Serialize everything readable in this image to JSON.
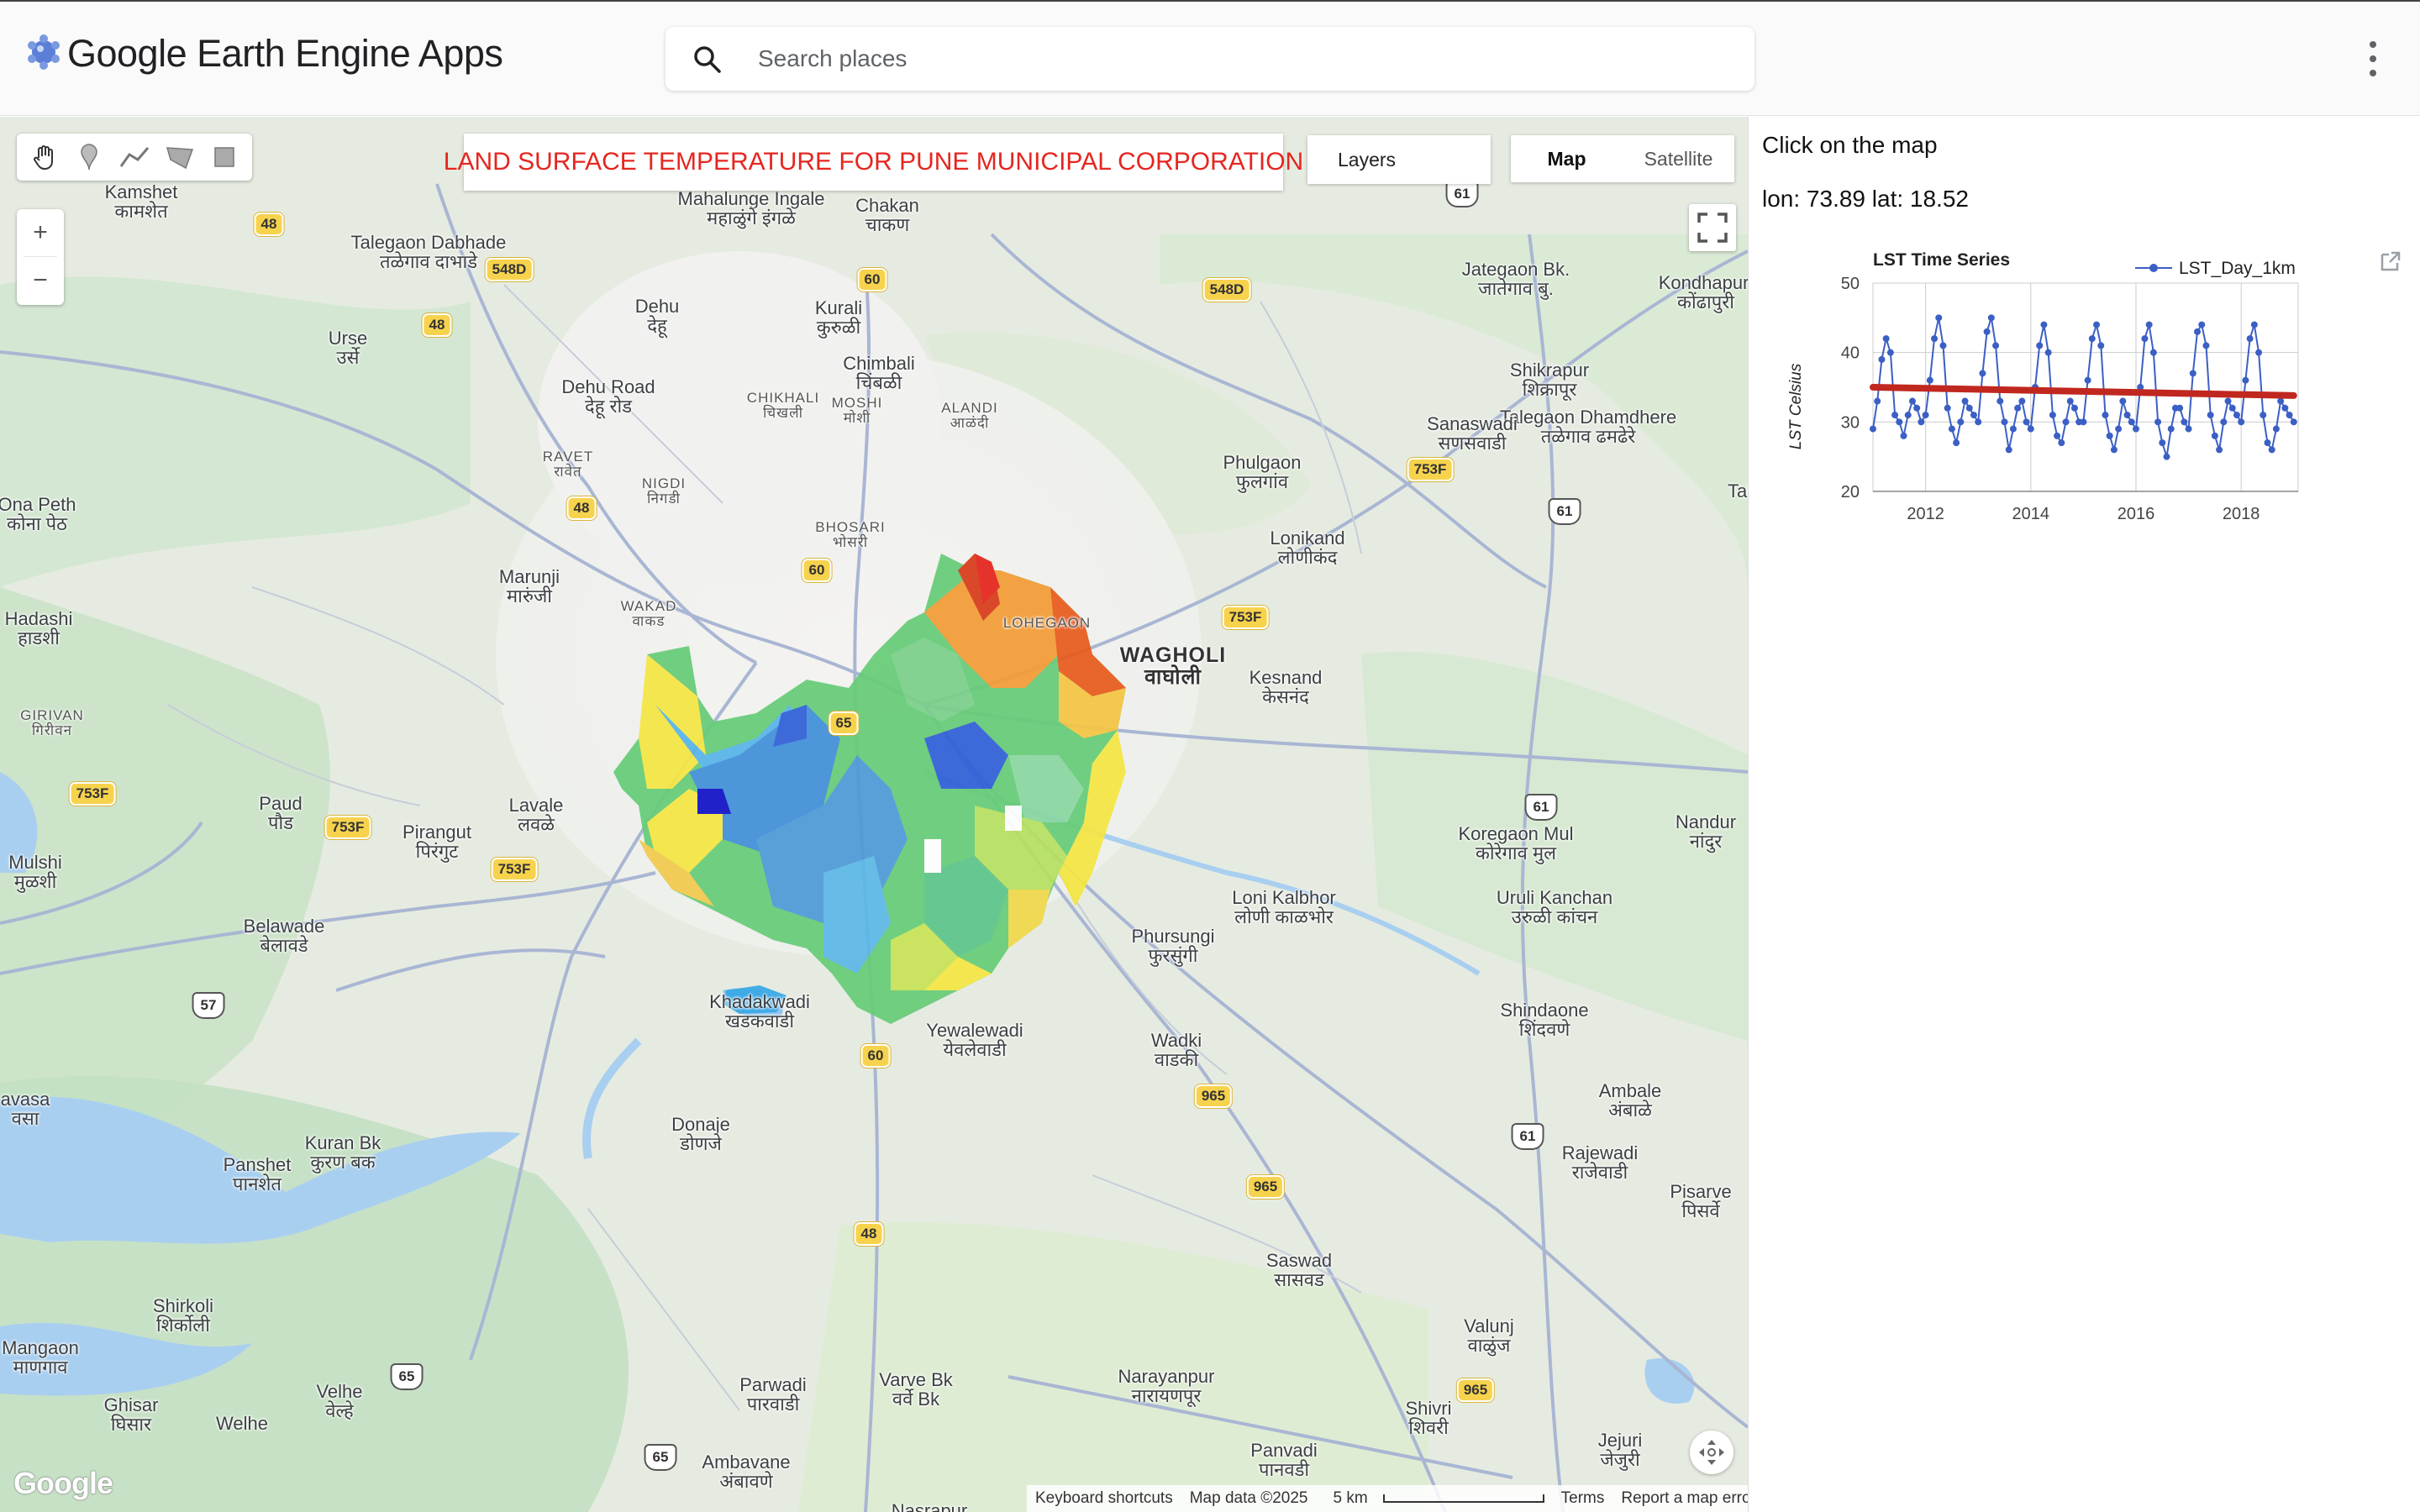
{
  "app": {
    "title": "Google Earth Engine Apps",
    "search_placeholder": "Search places",
    "accent_color": "#e5261f"
  },
  "map": {
    "title_panel": "LAND SURFACE TEMPERATURE FOR PUNE MUNICIPAL CORPORATION",
    "layers_label": "Layers",
    "map_type_options": [
      "Map",
      "Satellite"
    ],
    "selected_map_type": "Map",
    "zoom_in": "+",
    "zoom_out": "−",
    "google_logo": "Google",
    "footer": {
      "shortcuts": "Keyboard shortcuts",
      "attribution": "Map data ©2025",
      "scale": "5 km",
      "terms": "Terms",
      "report": "Report a map error"
    },
    "drawing_tools": [
      "hand-icon",
      "marker-icon",
      "polyline-icon",
      "polygon-icon",
      "rectangle-icon"
    ],
    "places": [
      {
        "name": "Kamshet",
        "local": "कामशेत"
      },
      {
        "name": "Talegaon Dabhade",
        "local": "तळेगाव दाभाडे"
      },
      {
        "name": "Mahalunge Ingale",
        "local": "महाळुंगे इंगळे"
      },
      {
        "name": "Chakan",
        "local": "चाकण"
      },
      {
        "name": "Jategaon Bk.",
        "local": "जातेगाव बु."
      },
      {
        "name": "Kondhapuri",
        "local": "कोंढापुरी"
      },
      {
        "name": "Urse",
        "local": "उर्से"
      },
      {
        "name": "Dehu",
        "local": "देहू"
      },
      {
        "name": "Kurali",
        "local": "कुरुळी"
      },
      {
        "name": "Chimbali",
        "local": "चिंबळी"
      },
      {
        "name": "Dehu Road",
        "local": "देहू रोड"
      },
      {
        "name": "CHIKHALI",
        "local": "चिखली"
      },
      {
        "name": "MOSHI",
        "local": "मोशी"
      },
      {
        "name": "ALANDI",
        "local": "आळंदी"
      },
      {
        "name": "Shikrapur",
        "local": "शिक्रापूर"
      },
      {
        "name": "Talegaon Dhamdhere",
        "local": "तळेगाव ढमढेरे"
      },
      {
        "name": "Sanaswadi",
        "local": "सणसवाडी"
      },
      {
        "name": "RAVET",
        "local": "रावेत"
      },
      {
        "name": "NIGDI",
        "local": "निगडी"
      },
      {
        "name": "Phulgaon",
        "local": "फुलगांव"
      },
      {
        "name": "Ona Peth",
        "local": "कोना पेठ"
      },
      {
        "name": "BHOSARI",
        "local": "भोसरी"
      },
      {
        "name": "Lonikand",
        "local": "लोणीकंद"
      },
      {
        "name": "Marunji",
        "local": "मारुंजी"
      },
      {
        "name": "WAKAD",
        "local": "वाकड"
      },
      {
        "name": "Hadashi",
        "local": "हाडशी"
      },
      {
        "name": "LOHEGAON",
        "local": ""
      },
      {
        "name": "WAGHOLI",
        "local": "वाघोली"
      },
      {
        "name": "Kesnand",
        "local": "केसनंद"
      },
      {
        "name": "GIRIVAN",
        "local": "गिरीवन"
      },
      {
        "name": "Paud",
        "local": "पौड"
      },
      {
        "name": "Lavale",
        "local": "लवळे"
      },
      {
        "name": "Pirangut",
        "local": "पिरंगुट"
      },
      {
        "name": "Koregaon Mul",
        "local": "कोरेगाव मुल"
      },
      {
        "name": "Nandur",
        "local": "नांदुर"
      },
      {
        "name": "Mulshi",
        "local": "मुळशी"
      },
      {
        "name": "Loni Kalbhor",
        "local": "लोणी काळभोर"
      },
      {
        "name": "Uruli Kanchan",
        "local": "उरुळी कांचन"
      },
      {
        "name": "Belawade",
        "local": "बेलावडे"
      },
      {
        "name": "Phursungi",
        "local": "फुरसुंगी"
      },
      {
        "name": "Khadakwadi",
        "local": "खडकवाडी"
      },
      {
        "name": "Yewalewadi",
        "local": "येवलेवाडी"
      },
      {
        "name": "Wadki",
        "local": "वाडकी"
      },
      {
        "name": "Shindaone",
        "local": "शिंदवणे"
      },
      {
        "name": "Ambale",
        "local": "अंबाळे"
      },
      {
        "name": "Kuran Bk",
        "local": "कुरण बक"
      },
      {
        "name": "Donaje",
        "local": "डोणजे"
      },
      {
        "name": "Panshet",
        "local": "पानशेत"
      },
      {
        "name": "Rajewadi",
        "local": "राजेवाडी"
      },
      {
        "name": "Pisarve",
        "local": "पिसर्वे"
      },
      {
        "name": "Saswad",
        "local": "सासवड"
      },
      {
        "name": "Valunj",
        "local": "वाळुंज"
      },
      {
        "name": "Shirkoli",
        "local": "शिर्कोली"
      },
      {
        "name": "Mangaon",
        "local": "माणगाव"
      },
      {
        "name": "Ghisar",
        "local": "घिसार"
      },
      {
        "name": "Velhe",
        "local": "वेल्हे"
      },
      {
        "name": "Welhe",
        "local": ""
      },
      {
        "name": "Parwadi",
        "local": "पारवाडी"
      },
      {
        "name": "Varve Bk",
        "local": "वर्वे Bk"
      },
      {
        "name": "Narayanpur",
        "local": "नारायणपूर"
      },
      {
        "name": "Shivri",
        "local": "शिवरी"
      },
      {
        "name": "Panvadi",
        "local": "पानवडी"
      },
      {
        "name": "Jejuri",
        "local": "जेजुरी"
      },
      {
        "name": "Ambavane",
        "local": "अंबावणे"
      },
      {
        "name": "Nasrapur",
        "local": ""
      },
      {
        "name": "avasa",
        "local": "वसा"
      },
      {
        "name": "Tal",
        "local": ""
      }
    ],
    "road_shields": [
      "48",
      "548D",
      "60",
      "548D",
      "61",
      "48",
      "48",
      "60",
      "753F",
      "61",
      "753F",
      "65",
      "753F",
      "753F",
      "61",
      "57",
      "60",
      "965",
      "61",
      "965",
      "48",
      "65",
      "965",
      "65",
      "753F"
    ]
  },
  "panel": {
    "click_text": "Click on the map",
    "coords_text": "lon: 73.89 lat: 18.52",
    "expand_icon": "open-in-new-icon"
  },
  "chart_data": {
    "type": "line",
    "title": "LST Time Series",
    "ylabel": "LST Celsius",
    "xlabel": "",
    "ylim": [
      20,
      50
    ],
    "xlim": [
      "2011-01",
      "2019-02"
    ],
    "xticks": [
      "2012",
      "2014",
      "2016",
      "2018"
    ],
    "yticks": [
      20,
      30,
      40,
      50
    ],
    "legend_position": "top-right",
    "grid": true,
    "series": [
      {
        "name": "LST_Day_1km",
        "color": "#3b5fc4",
        "x": [
          "2011-01",
          "2011-02",
          "2011-03",
          "2011-04",
          "2011-05",
          "2011-06",
          "2011-07",
          "2011-08",
          "2011-09",
          "2011-10",
          "2011-11",
          "2011-12",
          "2012-01",
          "2012-02",
          "2012-03",
          "2012-04",
          "2012-05",
          "2012-06",
          "2012-07",
          "2012-08",
          "2012-09",
          "2012-10",
          "2012-11",
          "2012-12",
          "2013-01",
          "2013-02",
          "2013-03",
          "2013-04",
          "2013-05",
          "2013-06",
          "2013-07",
          "2013-08",
          "2013-09",
          "2013-10",
          "2013-11",
          "2013-12",
          "2014-01",
          "2014-02",
          "2014-03",
          "2014-04",
          "2014-05",
          "2014-06",
          "2014-07",
          "2014-08",
          "2014-09",
          "2014-10",
          "2014-11",
          "2014-12",
          "2015-01",
          "2015-02",
          "2015-03",
          "2015-04",
          "2015-05",
          "2015-06",
          "2015-07",
          "2015-08",
          "2015-09",
          "2015-10",
          "2015-11",
          "2015-12",
          "2016-01",
          "2016-02",
          "2016-03",
          "2016-04",
          "2016-05",
          "2016-06",
          "2016-07",
          "2016-08",
          "2016-09",
          "2016-10",
          "2016-11",
          "2016-12",
          "2017-01",
          "2017-02",
          "2017-03",
          "2017-04",
          "2017-05",
          "2017-06",
          "2017-07",
          "2017-08",
          "2017-09",
          "2017-10",
          "2017-11",
          "2017-12",
          "2018-01",
          "2018-02",
          "2018-03",
          "2018-04",
          "2018-05",
          "2018-06",
          "2018-07",
          "2018-08",
          "2018-09",
          "2018-10",
          "2018-11",
          "2018-12",
          "2019-01"
        ],
        "values": [
          29,
          33,
          39,
          42,
          40,
          31,
          30,
          28,
          31,
          33,
          32,
          30,
          31,
          36,
          42,
          45,
          41,
          32,
          29,
          27,
          30,
          33,
          32,
          31,
          30,
          37,
          43,
          45,
          41,
          33,
          30,
          26,
          29,
          32,
          33,
          30,
          29,
          35,
          41,
          44,
          40,
          31,
          28,
          27,
          30,
          33,
          32,
          30,
          30,
          36,
          42,
          44,
          41,
          31,
          28,
          26,
          29,
          33,
          31,
          30,
          29,
          35,
          42,
          44,
          40,
          30,
          27,
          25,
          29,
          32,
          32,
          30,
          29,
          37,
          43,
          44,
          41,
          31,
          28,
          26,
          30,
          33,
          32,
          31,
          30,
          36,
          42,
          44,
          40,
          31,
          27,
          26,
          29,
          33,
          32,
          31,
          30
        ]
      },
      {
        "name": "trend",
        "color": "#c0281f",
        "x": [
          "2011-01",
          "2019-01"
        ],
        "values": [
          35,
          33.8
        ]
      }
    ]
  }
}
